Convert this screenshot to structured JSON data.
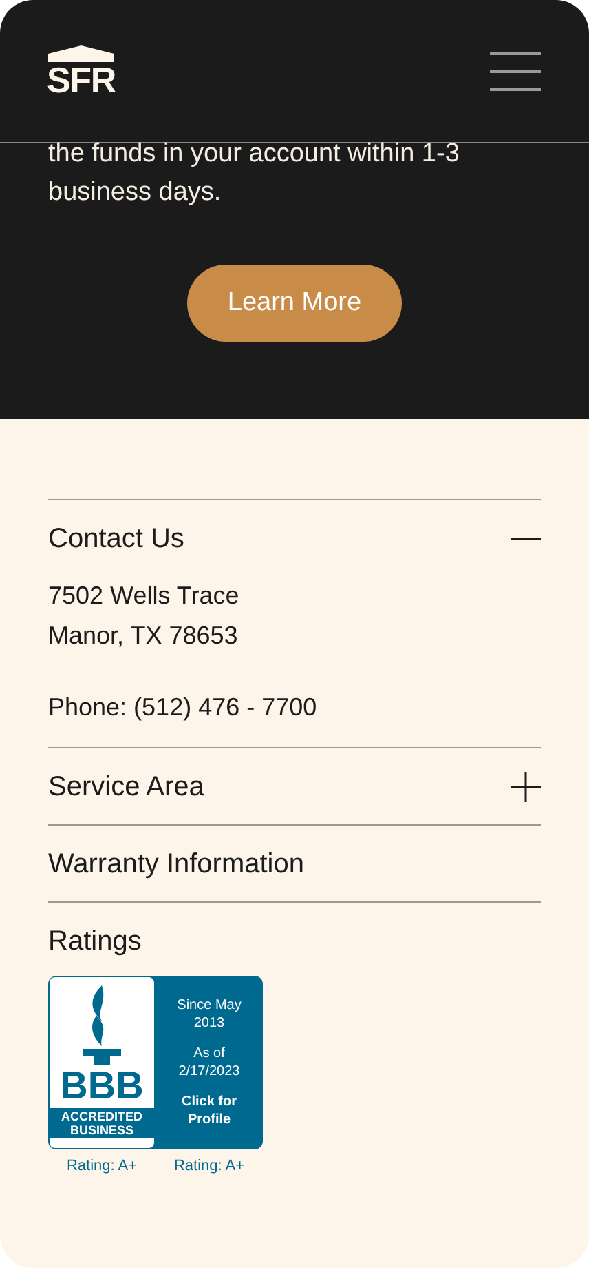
{
  "header": {
    "logo": "SFR"
  },
  "hero": {
    "text": "the funds in your account within 1-3 business days.",
    "button": "Learn More"
  },
  "sections": [
    {
      "kind": "accordion",
      "title": "Contact Us",
      "expanded": true,
      "lines": [
        "7502 Wells Trace",
        "Manor, TX 78653"
      ],
      "phone": "Phone: (512) 476 - 7700"
    },
    {
      "kind": "accordion",
      "title": "Service Area",
      "expanded": false
    },
    {
      "kind": "plain",
      "title": "Warranty Information"
    },
    {
      "kind": "plain",
      "title": "Ratings"
    }
  ],
  "badge": {
    "letters": "BBB",
    "line1": "ACCREDITED",
    "line2": "BUSINESS",
    "since": "Since May 2013",
    "as_of": "As of 2/17/2023",
    "cta": "Click for Profile",
    "ratings": [
      "Rating: A+",
      "Rating: A+"
    ]
  }
}
